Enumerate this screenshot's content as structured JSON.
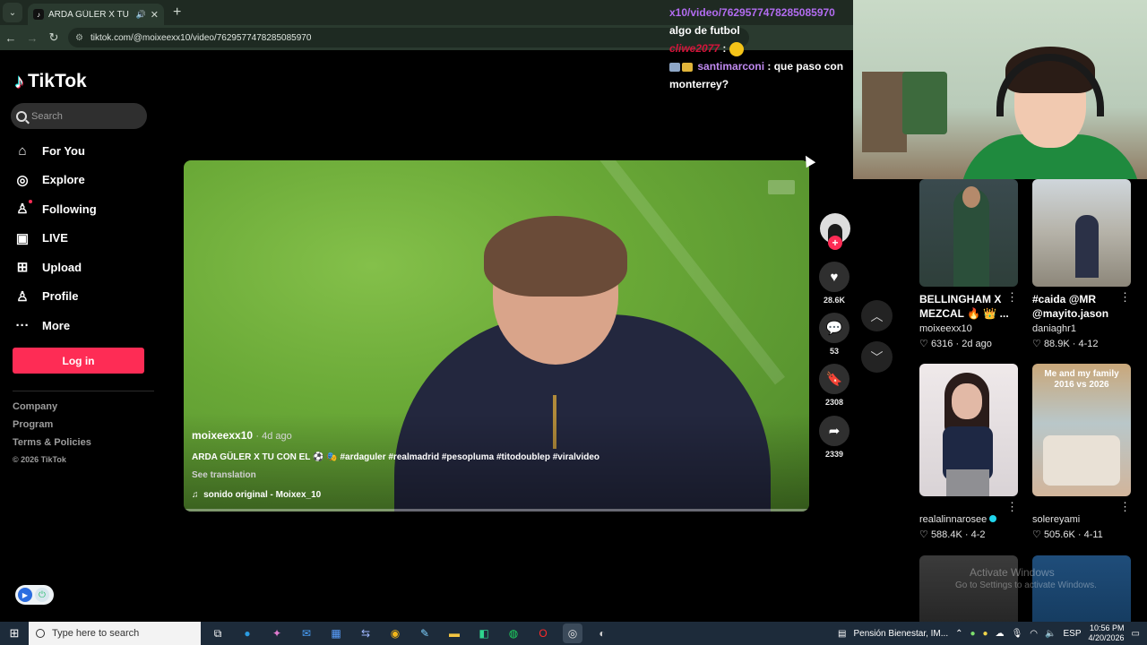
{
  "browser": {
    "tab_title": "ARDA GÜLER X TU CON EL",
    "url": "tiktok.com/@moixeexx10/video/7629577478285085970"
  },
  "sidebar": {
    "brand": "TikTok",
    "search_placeholder": "Search",
    "nav": [
      {
        "label": "For You",
        "icon": "home-icon"
      },
      {
        "label": "Explore",
        "icon": "compass-icon"
      },
      {
        "label": "Following",
        "icon": "following-icon"
      },
      {
        "label": "LIVE",
        "icon": "live-icon"
      },
      {
        "label": "Upload",
        "icon": "upload-icon"
      },
      {
        "label": "Profile",
        "icon": "profile-icon"
      },
      {
        "label": "More",
        "icon": "more-icon"
      }
    ],
    "login_label": "Log in",
    "footer": [
      "Company",
      "Program",
      "Terms & Policies",
      "© 2026 TikTok"
    ]
  },
  "video": {
    "author": "moixeexx10",
    "ago": "· 4d ago",
    "description": "ARDA GÜLER X TU CON EL ⚽ 🎭 #ardaguler #realmadrid #pesopluma #titodoublep #viralvideo",
    "see_translation": "See translation",
    "sound": "sonido original - Moixex_10",
    "likes": "28.6K",
    "comments": "53",
    "saves": "2308",
    "shares": "2339"
  },
  "chat": {
    "line1_link": "x10/video/7629577478285085970",
    "line2": "algo de futbol",
    "line3_user": "cliwe2077",
    "line4_user": "santimarconi",
    "line4_msg": ": que paso con monterrey?"
  },
  "feed": [
    {
      "title": "BELLINGHAM X MEZCAL 🔥 👑 ...",
      "author": "moixeexx10",
      "likes": "6316",
      "date": "2d ago"
    },
    {
      "title": "#caida @MR @mayito.jason",
      "author": "daniaghr1",
      "likes": "88.9K",
      "date": "4-12"
    },
    {
      "title": "",
      "author": "realalinnarosee",
      "likes": "588.4K",
      "date": "4-2"
    },
    {
      "title": "",
      "author": "solereyami",
      "likes": "505.6K",
      "date": "4-11"
    }
  ],
  "feed_thumb_text": "Me and my family 2016 vs 2026",
  "watermark": {
    "line1": "Activate Windows",
    "line2": "Go to Settings to activate Windows."
  },
  "taskbar": {
    "search_placeholder": "Type here to search",
    "weather": "Pensión Bienestar, IM...",
    "language": "ESP",
    "time": "10:56 PM",
    "date": "4/20/2026"
  }
}
